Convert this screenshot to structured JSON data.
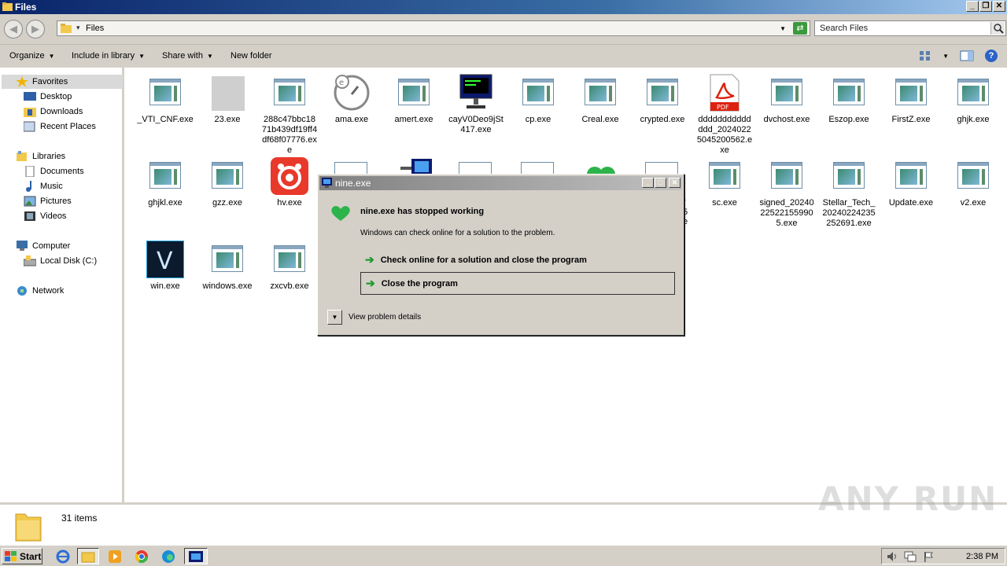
{
  "window": {
    "title": "Files",
    "btn_min": "_",
    "btn_restore": "❐",
    "btn_close": "✕"
  },
  "address": {
    "path": "Files",
    "search_placeholder": "Search Files"
  },
  "toolbar": {
    "organize": "Organize",
    "include": "Include in library",
    "share": "Share with",
    "new_folder": "New folder"
  },
  "nav": {
    "favorites": "Favorites",
    "desktop": "Desktop",
    "downloads": "Downloads",
    "recent": "Recent Places",
    "libraries": "Libraries",
    "documents": "Documents",
    "music": "Music",
    "pictures": "Pictures",
    "videos": "Videos",
    "computer": "Computer",
    "local_disk": "Local Disk (C:)",
    "network": "Network"
  },
  "files": {
    "f1": "_VTI_CNF.exe",
    "f2": "23.exe",
    "f3": "288c47bbc1871b439df19ff4df68f07776.exe",
    "f4": "ama.exe",
    "f5": "amert.exe",
    "f6": "cayV0Deo9jSt417.exe",
    "f7": "cp.exe",
    "f8": "Creal.exe",
    "f9": "crypted.exe",
    "f10": "dddddddddddddd_20240225045200562.exe",
    "f11": "dvchost.exe",
    "f12": "Eszop.exe",
    "f13": "FirstZ.exe",
    "f14": "ghjk.exe",
    "f15": "ghjkl.exe",
    "f16": "gzz.exe",
    "f17": "hv.exe",
    "f18": "sc.exe",
    "f19": "signed_20240225221559905.exe",
    "f20": "Stellar_Tech_20240224235252691.exe",
    "f21": "Update.exe",
    "f22": "v2.exe",
    "f23": "win.exe",
    "f24": "windows.exe",
    "f25": "zxcvb.exe",
    "hidden_partial_1": "r",
    "hidden_partial_2": "5",
    "hidden_partial_3": "e"
  },
  "status": {
    "count": "31 items"
  },
  "watermark": "ANY RUN",
  "dialog": {
    "title": "nine.exe",
    "heading": "nine.exe has stopped working",
    "sub": "Windows can check online for a solution to the problem.",
    "option1": "Check online for a solution and close the program",
    "option2": "Close the program",
    "details": "View problem details",
    "btn_min": "_",
    "btn_max": "□",
    "btn_close": "✕"
  },
  "taskbar": {
    "start": "Start",
    "clock": "2:38 PM"
  },
  "colors": {
    "accent_green": "#1e9b2e",
    "title_blue": "#0a246a"
  }
}
